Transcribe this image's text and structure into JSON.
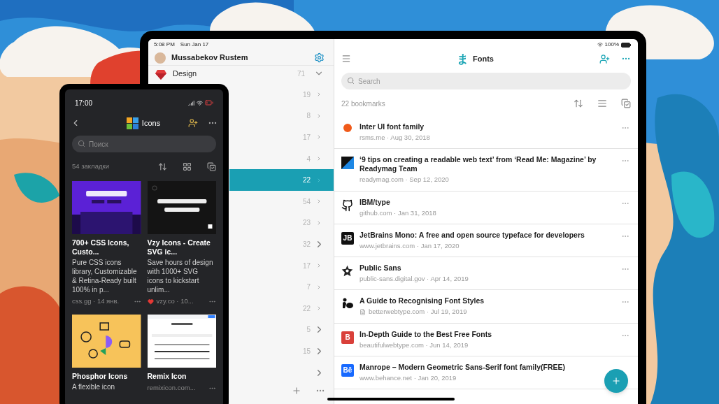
{
  "tablet": {
    "status_bar": {
      "time": "5:08 PM",
      "date": "Sun Jan 17",
      "battery": "100%"
    },
    "sidebar": {
      "user": {
        "name": "Mussabekov Rustem"
      },
      "group": {
        "name": "Design",
        "count": "71",
        "expanded": true
      },
      "rows": [
        {
          "count": "19",
          "expandable": false,
          "selected": false
        },
        {
          "count": "8",
          "expandable": false,
          "selected": false
        },
        {
          "count": "17",
          "expandable": false,
          "selected": false
        },
        {
          "count": "4",
          "expandable": false,
          "selected": false
        },
        {
          "count": "22",
          "expandable": false,
          "selected": true
        },
        {
          "count": "54",
          "expandable": false,
          "selected": false
        },
        {
          "count": "23",
          "expandable": false,
          "selected": false
        },
        {
          "count": "32",
          "expandable": true,
          "selected": false
        },
        {
          "count": "17",
          "expandable": false,
          "selected": false
        },
        {
          "count": "7",
          "expandable": false,
          "selected": false
        },
        {
          "count": "22",
          "expandable": false,
          "selected": false
        },
        {
          "count": "5",
          "expandable": true,
          "selected": false
        },
        {
          "count": "15",
          "expandable": true,
          "selected": false
        },
        {
          "expandable": true,
          "selected": false
        }
      ]
    },
    "header": {
      "logo": "ま",
      "title": "Fonts"
    },
    "search": {
      "placeholder": "Search"
    },
    "count": "22 bookmarks",
    "bookmarks": [
      {
        "kind": "dot",
        "color": "#f05a1a",
        "title": "Inter UI font family",
        "meta": "rsms.me · Aug 30, 2018",
        "article": false
      },
      {
        "kind": "split",
        "color": "#1e88e5",
        "title": "‘9 tips on creating a readable web text’ from ‘Read Me: Magazine’ by Readymag Team",
        "meta": "readymag.com · Sep 12, 2020",
        "article": false
      },
      {
        "kind": "github",
        "color": "#111111",
        "title": "IBM/type",
        "meta": "github.com · Jan 31, 2018",
        "article": false
      },
      {
        "kind": "badge",
        "color": "#111111",
        "badge": "JB",
        "title": "JetBrains Mono: A free and open source typeface for developers",
        "meta": "www.jetbrains.com · Jan 17, 2020",
        "article": false
      },
      {
        "kind": "star",
        "color": "#222222",
        "title": "Public Sans",
        "meta": "public-sans.digital.gov · Apr 14, 2019",
        "article": false
      },
      {
        "kind": "figure",
        "color": "#111111",
        "title": "A Guide to Recognising Font Styles",
        "meta": "betterwebtype.com · Jul 19, 2019",
        "article": true
      },
      {
        "kind": "badge",
        "color": "#d9403a",
        "badge": "B",
        "title": "In-Depth Guide to the Best Free Fonts",
        "meta": "beautifulwebtype.com · Jun 14, 2019",
        "article": false
      },
      {
        "kind": "badge",
        "color": "#1769ff",
        "badge": "Bē",
        "title": "Manrope – Modern Geometric Sans-Serif font family(FREE)",
        "meta": "www.behance.net · Jan 20, 2019",
        "article": false
      }
    ]
  },
  "phone": {
    "status_bar": {
      "time": "17:00"
    },
    "header": {
      "title": "Icons"
    },
    "search": {
      "placeholder": "Поиск"
    },
    "count": "54 закладки",
    "cards": [
      {
        "color": "#5b21d6",
        "title": "700+ CSS Icons, Custo...",
        "description": "Pure CSS icons library, Customizable & Retina-Ready built 100% in p...",
        "meta": "css.gg · 14 янв."
      },
      {
        "color": "#141414",
        "title": "Vzy Icons - Create SVG ic...",
        "description": "Save hours of design with 1000+ SVG icons to kickstart unlim...",
        "meta": "vzy.co · 10...",
        "favorite": true
      },
      {
        "color": "#f7c35a",
        "title": "Phosphor Icons",
        "description": "A flexible icon"
      },
      {
        "color": "#ffffff",
        "title": "Remix Icon",
        "meta": "remixicon.com..."
      }
    ]
  }
}
